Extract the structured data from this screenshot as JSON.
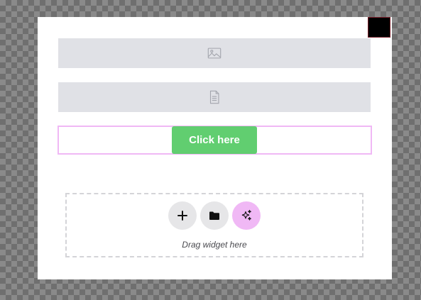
{
  "popup": {
    "close_icon": "close-icon",
    "close_color": "#000000"
  },
  "placeholders": [
    {
      "icon": "image-icon"
    },
    {
      "icon": "document-icon"
    }
  ],
  "cta": {
    "label": "Click here",
    "color": "#61ce70",
    "section_outline_color": "#f0b8f5"
  },
  "drop_zone": {
    "hint": "Drag widget here",
    "actions": [
      {
        "icon": "plus-icon"
      },
      {
        "icon": "folder-icon"
      },
      {
        "icon": "ai-sparkle-icon",
        "color": "#f0b8f5"
      }
    ]
  }
}
